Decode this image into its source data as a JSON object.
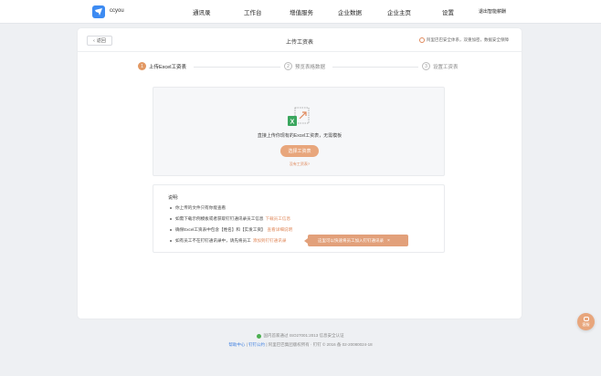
{
  "header": {
    "brand": "ccyou",
    "nav": [
      "通讯录",
      "工作台",
      "增值服务",
      "企业数据",
      "企业主页",
      "设置"
    ],
    "user_action": "退出智能薪酬"
  },
  "card": {
    "back_label": "返回",
    "title": "上传工资表",
    "security_note": "阿里巴巴安全体系，双重加密，数据安全保障"
  },
  "steps": [
    {
      "num": "1",
      "label": "上传Excel工资表",
      "state": "active"
    },
    {
      "num": "2",
      "label": "预览表格数据",
      "state": "inactive"
    },
    {
      "num": "3",
      "label": "设置工资表",
      "state": "inactive"
    }
  ],
  "upload": {
    "hint": "直接上传你现有的Excel工资表，无需模板",
    "button": "选择工资表",
    "no_file_link": "没有工资表?"
  },
  "notes": {
    "title": "说明:",
    "items": [
      {
        "text": "你上传的文件只有你能查看",
        "link": ""
      },
      {
        "text": "如需下载示例模板或者获取钉钉通讯录员工信息",
        "link": "下载员工信息"
      },
      {
        "text": "确保Excel工资表中包含【姓名】和【实发工资】",
        "link": "查看详细说明"
      },
      {
        "text": "如有员工不在钉钉通讯录中，请先将员工",
        "link": "添加到钉钉通讯录"
      }
    ]
  },
  "tooltip": {
    "text": "这里可以快速将员工加入钉钉通讯录",
    "close": "×"
  },
  "footer": {
    "security": "国内首家通过 ISO27001:2013 信息安全认证",
    "help_link": "帮助中心",
    "public_link": "钉钉公约",
    "copyright": "阿里巴巴集团版权所有 · 钉钉 © 2016 备 02-20080024-18"
  },
  "help_fab": {
    "label": "客服"
  },
  "colors": {
    "accent": "#e29863",
    "link_blue": "#3d7fe0",
    "logo_blue": "#3d8bf2"
  }
}
